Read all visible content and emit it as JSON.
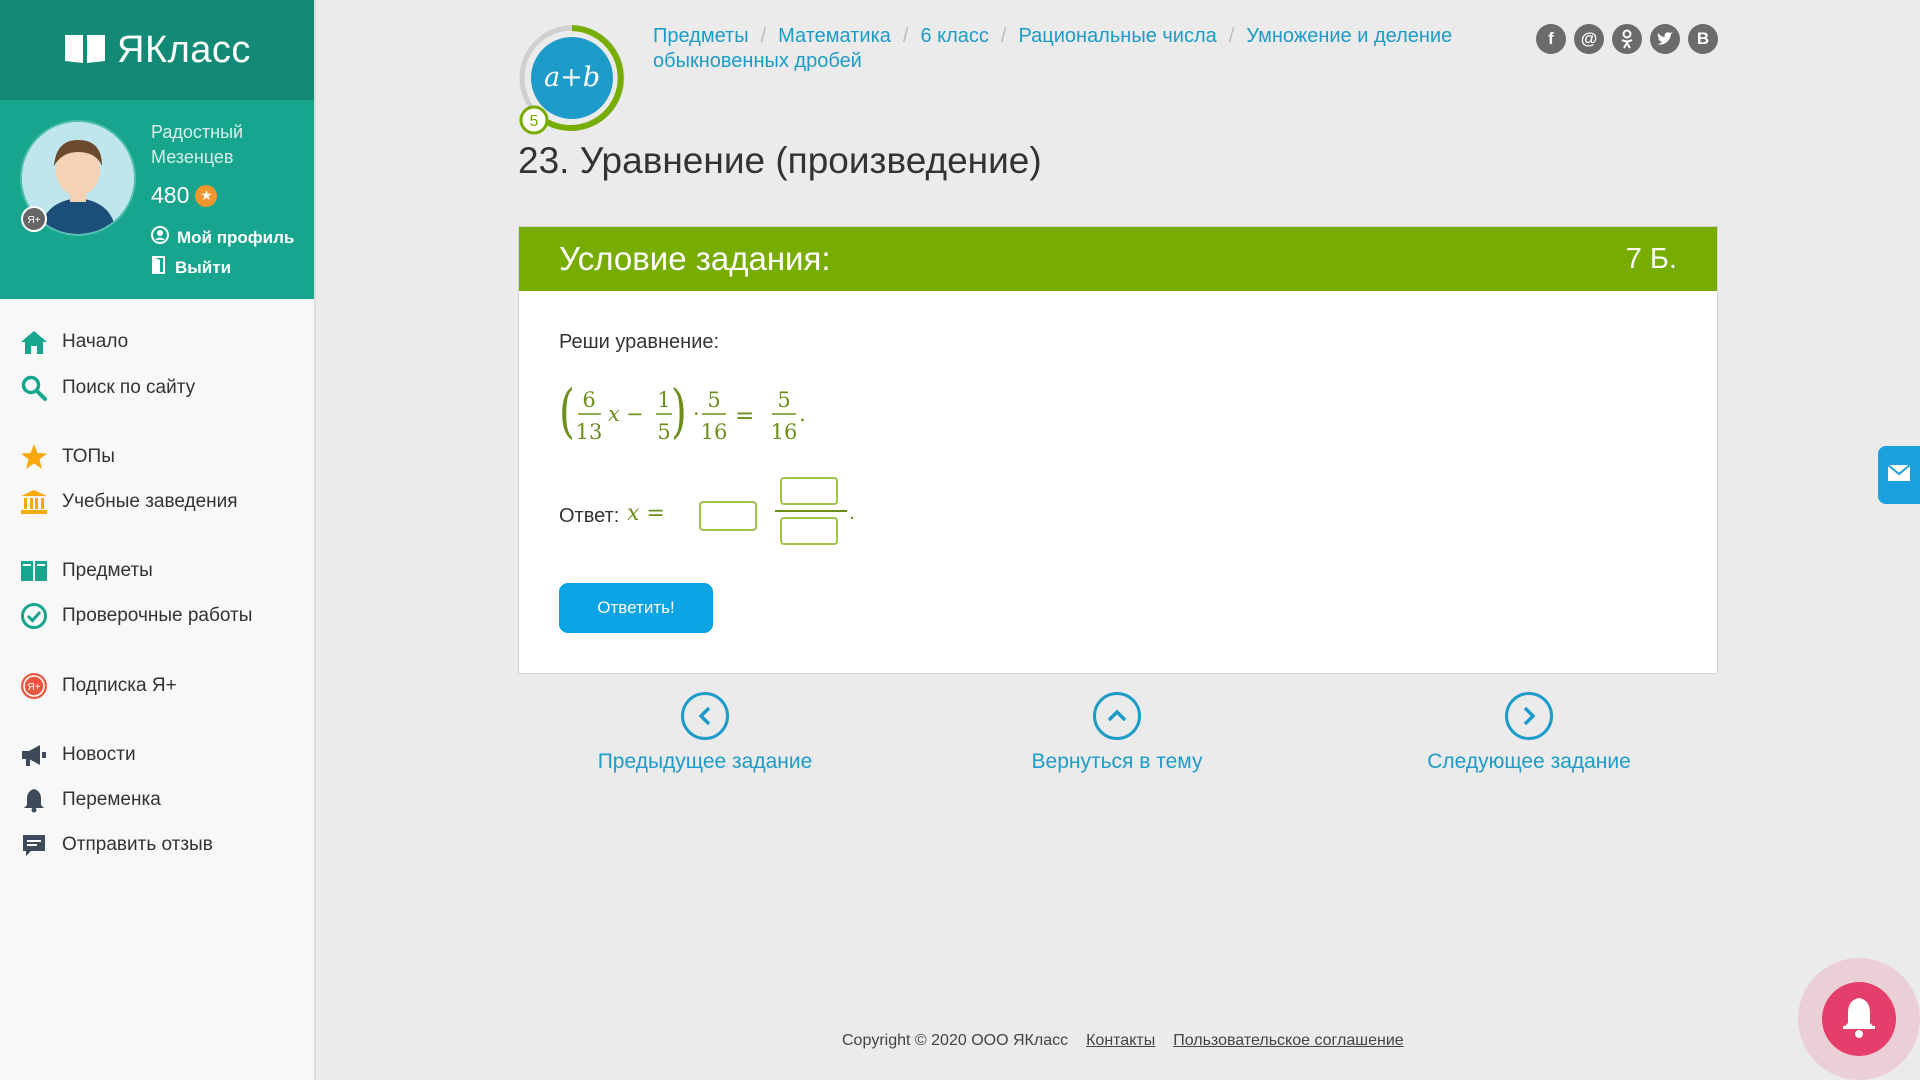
{
  "sidebar": {
    "logo": "ЯКласс",
    "user_name": "Радостный Мезенцев",
    "badge": "Я+",
    "points": "480",
    "profile_link": "Мой профиль",
    "logout_link": "Выйти",
    "items": [
      {
        "label": "Начало",
        "icon": "home-icon"
      },
      {
        "label": "Поиск по сайту",
        "icon": "search-icon"
      },
      {
        "label": "ТОПы",
        "icon": "star-icon"
      },
      {
        "label": "Учебные заведения",
        "icon": "school-icon"
      },
      {
        "label": "Предметы",
        "icon": "books-icon"
      },
      {
        "label": "Проверочные работы",
        "icon": "check-circle-icon"
      },
      {
        "label": "Подписка Я+",
        "icon": "subscription-icon"
      },
      {
        "label": "Новости",
        "icon": "megaphone-icon"
      },
      {
        "label": "Переменка",
        "icon": "bell-icon"
      },
      {
        "label": "Отправить отзыв",
        "icon": "feedback-icon"
      }
    ]
  },
  "header": {
    "topic_badge_text": "a+b",
    "topic_level": "5",
    "breadcrumbs": [
      "Предметы",
      "Математика",
      "6 класс",
      "Рациональные числа",
      "Умножение и деление обыкновенных дробей"
    ],
    "social": [
      "f",
      "@",
      "ok",
      "tw",
      "В"
    ],
    "page_title": "23. Уравнение (произведение)"
  },
  "task": {
    "header_title": "Условие задания:",
    "points": "7 Б.",
    "prompt": "Реши уравнение:",
    "equation": {
      "a_num": "6",
      "a_den": "13",
      "var": "x",
      "b_num": "1",
      "b_den": "5",
      "c_num": "5",
      "c_den": "16",
      "d_num": "5",
      "d_den": "16"
    },
    "answer_label": "Ответ:",
    "answer_var": "x =",
    "answer_whole": "",
    "answer_num": "",
    "answer_den": "",
    "submit_label": "Ответить!"
  },
  "nav": {
    "prev": "Предыдущее задание",
    "back": "Вернуться в тему",
    "next": "Следующее задание"
  },
  "footer": {
    "copyright": "Copyright © 2020 ООО ЯКласс",
    "contacts": "Контакты",
    "agreement": "Пользовательское соглашение"
  },
  "colors": {
    "brand_teal": "#17a58d",
    "task_green": "#77ad00",
    "link_blue": "#1d9bc9",
    "button_blue": "#0aa4e4",
    "math_green": "#6b8f1a"
  }
}
